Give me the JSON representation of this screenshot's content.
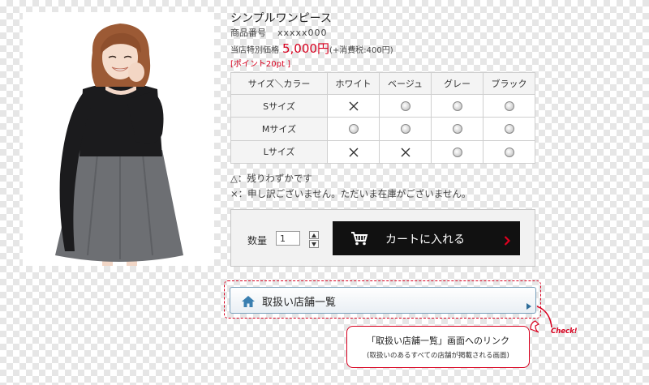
{
  "product": {
    "title": "シンプルワンピース",
    "code_label": "商品番号",
    "code_value": "xxxxx000",
    "price_label": "当店特別価格",
    "price_value": "5,000円",
    "tax_note": "(+消費税:400円)",
    "points": "[ポイント20pt ]"
  },
  "stock_table": {
    "corner_header": "サイズ＼カラー",
    "columns": [
      "ホワイト",
      "ベージュ",
      "グレー",
      "ブラック"
    ],
    "rows": [
      {
        "label": "Sサイズ",
        "cells": [
          "cross",
          "radio",
          "radio",
          "radio"
        ]
      },
      {
        "label": "Mサイズ",
        "cells": [
          "radio",
          "radio",
          "radio",
          "radio"
        ]
      },
      {
        "label": "Lサイズ",
        "cells": [
          "cross",
          "cross",
          "radio",
          "radio"
        ]
      }
    ]
  },
  "legend": {
    "few_left": "△：残りわずかです",
    "sold_out": "×：申し訳ございません。ただいま在庫がございません。"
  },
  "cart": {
    "qty_label": "数量",
    "qty_value": "1",
    "button_label": "カートに入れる"
  },
  "shops": {
    "button_label": "取扱い店舗一覧"
  },
  "callout": {
    "check_label": "Check!",
    "title": "「取扱い店舗一覧」画面へのリンク",
    "subtitle": "(取扱いのあるすべての店舗が掲載される画面)"
  },
  "colors": {
    "accent_red": "#d8001f",
    "cart_button_bg": "#111111",
    "link_border": "#7aa0bc"
  },
  "icons": [
    "cart-icon",
    "chevron-right-icon",
    "home-icon",
    "cross-icon",
    "radio-icon",
    "up-arrow-icon",
    "down-arrow-icon"
  ]
}
